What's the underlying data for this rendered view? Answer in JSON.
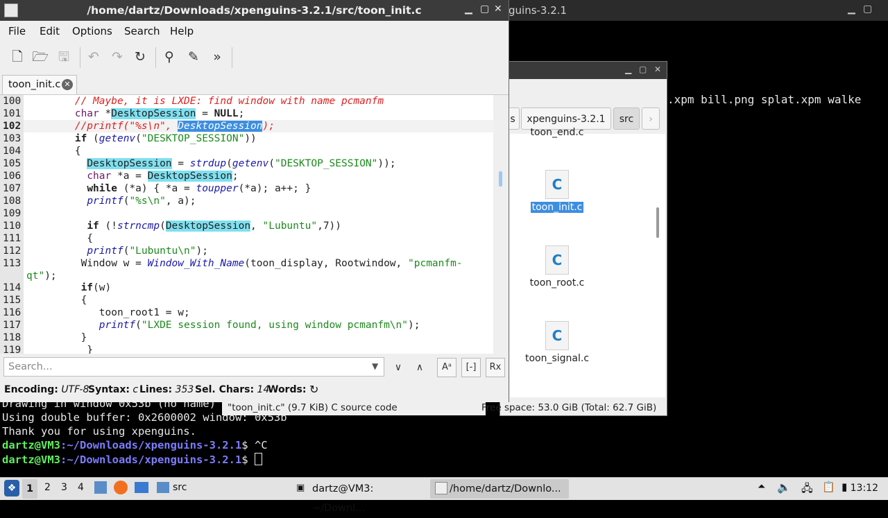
{
  "terminal": {
    "title_fragment": "guins-3.2.1",
    "right_line": ".xpm bill.png splat.xpm walke",
    "lines": [
      "Drawing in window 0x53b (no name)",
      "Using double buffer: 0x2600002 window: 0x53b",
      "Thank you for using xpenguins."
    ],
    "prompt_user": "dartz@VM3",
    "prompt_path": ":~/Downloads/xpenguins-3.2.1",
    "prompt_end": "$ ",
    "cmd1": "^C",
    "cmd2": ""
  },
  "file_manager": {
    "breadcrumbs": [
      "s",
      "xpenguins-3.2.1",
      "src"
    ],
    "files": [
      {
        "name": "toon_end.c",
        "icon": "C"
      },
      {
        "name": "toon_init.c",
        "icon": "C"
      },
      {
        "name": "toon_root.c",
        "icon": "C"
      },
      {
        "name": "toon_signal.c",
        "icon": "C"
      }
    ],
    "status_left": "\"toon_init.c\" (9.7 KiB) C source code",
    "free_space": "Free space: 53.0 GiB (Total: 62.7 GiB)"
  },
  "editor": {
    "title": "/home/dartz/Downloads/xpenguins-3.2.1/src/toon_init.c",
    "menu": [
      "File",
      "Edit",
      "Options",
      "Search",
      "Help"
    ],
    "tab_label": "toon_init.c",
    "search_placeholder": "Search...",
    "status": {
      "encoding_label": "Encoding:",
      "encoding": "UTF-8",
      "syntax_label": "Syntax:",
      "syntax": "c",
      "lines_label": "Lines:",
      "lines": "353",
      "sel_label": "Sel. Chars:",
      "sel": "14",
      "words_label": "Words:"
    },
    "line_numbers": [
      "100",
      "101",
      "102",
      "103",
      "104",
      "105",
      "106",
      "107",
      "108",
      "109",
      "110",
      "111",
      "112",
      "113",
      "",
      "114",
      "115",
      "116",
      "117",
      "118",
      "119"
    ]
  },
  "taskbar": {
    "workspaces": [
      "1",
      "2",
      "3",
      "4"
    ],
    "folder_label": "src",
    "task1": "dartz@VM3: ~/Downl...",
    "task2": "/home/dartz/Downlo...",
    "clock": "13:12"
  }
}
